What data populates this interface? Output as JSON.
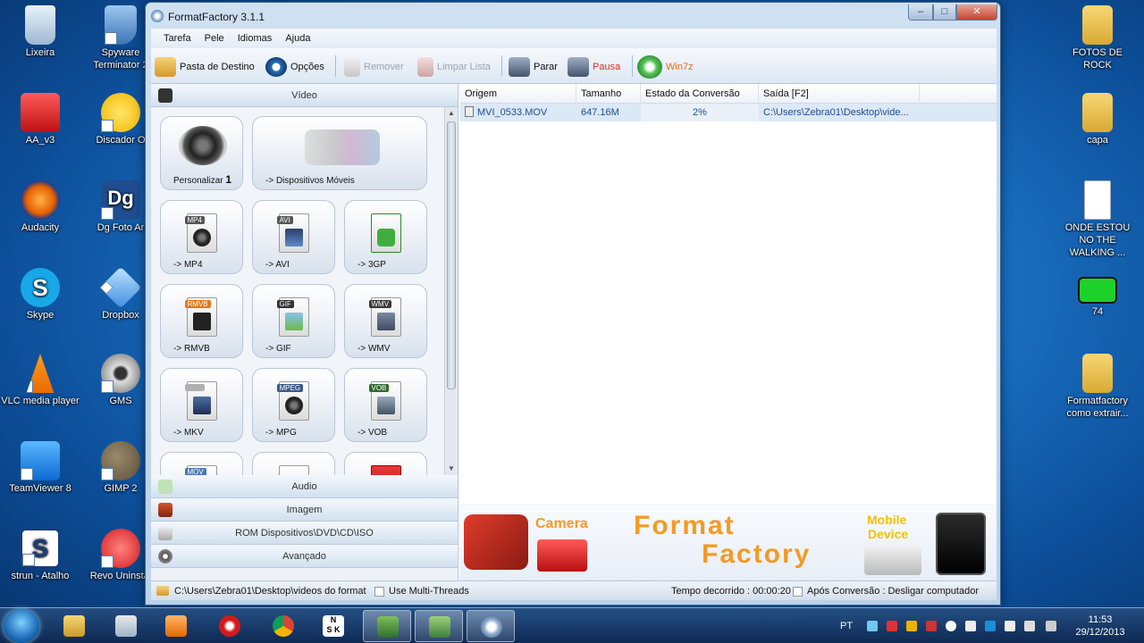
{
  "desktop": {
    "left_icons": [
      {
        "label": "Lixeira",
        "icon": "recycle-bin-icon"
      },
      {
        "label": "AA_v3",
        "icon": "aa-app-icon"
      },
      {
        "label": "Audacity",
        "icon": "audacity-icon"
      },
      {
        "label": "Skype",
        "icon": "skype-icon"
      },
      {
        "label": "VLC media player",
        "icon": "vlc-icon"
      },
      {
        "label": "TeamViewer 8",
        "icon": "teamviewer-icon"
      },
      {
        "label": "strun - Atalho",
        "icon": "strun-icon"
      }
    ],
    "second_icons": [
      {
        "label": "Spyware Terminator 2",
        "icon": "shield-icon"
      },
      {
        "label": "Discador O",
        "icon": "discador-icon"
      },
      {
        "label": "Dg Foto Ar",
        "icon": "dg-foto-icon"
      },
      {
        "label": "Dropbox",
        "icon": "dropbox-icon"
      },
      {
        "label": "GMS",
        "icon": "webcam-icon"
      },
      {
        "label": "GIMP 2",
        "icon": "gimp-icon"
      },
      {
        "label": "Revo Uninstal",
        "icon": "revo-uninstaller-icon"
      }
    ],
    "right_icons": [
      {
        "label": "FOTOS DE ROCK",
        "icon": "folder-icon"
      },
      {
        "label": "capa",
        "icon": "folder-icon"
      },
      {
        "label": "ONDE ESTOU NO THE WALKING ...",
        "icon": "document-icon"
      },
      {
        "label": "74",
        "icon": "image-icon"
      },
      {
        "label": "Formatfactory como extrair...",
        "icon": "folder-icon"
      }
    ]
  },
  "window": {
    "title": "FormatFactory 3.1.1",
    "menu": [
      "Tarefa",
      "Pele",
      "Idiomas",
      "Ajuda"
    ],
    "toolbar": {
      "dest": "Pasta de Destino",
      "options": "Opções",
      "remove": "Remover",
      "clear": "Limpar Lista",
      "stop": "Parar",
      "pause": "Pausa",
      "win7z": "Win7z"
    },
    "categories": {
      "video": "Vídeo",
      "audio": "Audio",
      "image": "Imagem",
      "rom": "ROM Dispositivos\\DVD\\CD\\ISO",
      "advanced": "Avançado"
    },
    "tiles": {
      "custom": "Personalizar",
      "custom_badge": "1",
      "mobile": "-> Dispositivos Móveis",
      "mp4": "-> MP4",
      "mp4_tag": "MP4",
      "avi": "-> AVI",
      "avi_tag": "AVI",
      "3gp": "-> 3GP",
      "rmvb": "-> RMVB",
      "rmvb_tag": "RMVB",
      "gif": "-> GIF",
      "gif_tag": "GIF",
      "wmv": "-> WMV",
      "wmv_tag": "WMV",
      "mkv": "-> MKV",
      "mpg": "-> MPG",
      "mpg_tag": "MPEG",
      "vob": "-> VOB",
      "vob_tag": "VOB",
      "mov_tag": "MOV"
    },
    "table": {
      "headers": [
        "Origem",
        "Tamanho",
        "Estado da Conversão",
        "Saída [F2]"
      ],
      "rows": [
        {
          "origem": "MVI_0533.MOV",
          "tamanho": "647.16M",
          "estado": "2%",
          "saida": "C:\\Users\\Zebra01\\Desktop\\vide..."
        }
      ]
    },
    "banner": {
      "camera": "Camera",
      "brand_line1": "Format",
      "brand_line2": "Factory",
      "mobile_line1": "Mobile",
      "mobile_line2": "Device"
    },
    "status": {
      "path": "C:\\Users\\Zebra01\\Desktop\\videos do format",
      "multithreads": "Use Multi-Threads",
      "elapsed": "Tempo decorrido : 00:00:20",
      "after": "Após Conversão : Desligar computador"
    }
  },
  "taskbar": {
    "lang": "PT",
    "time": "11:53",
    "date": "29/12/2013"
  }
}
